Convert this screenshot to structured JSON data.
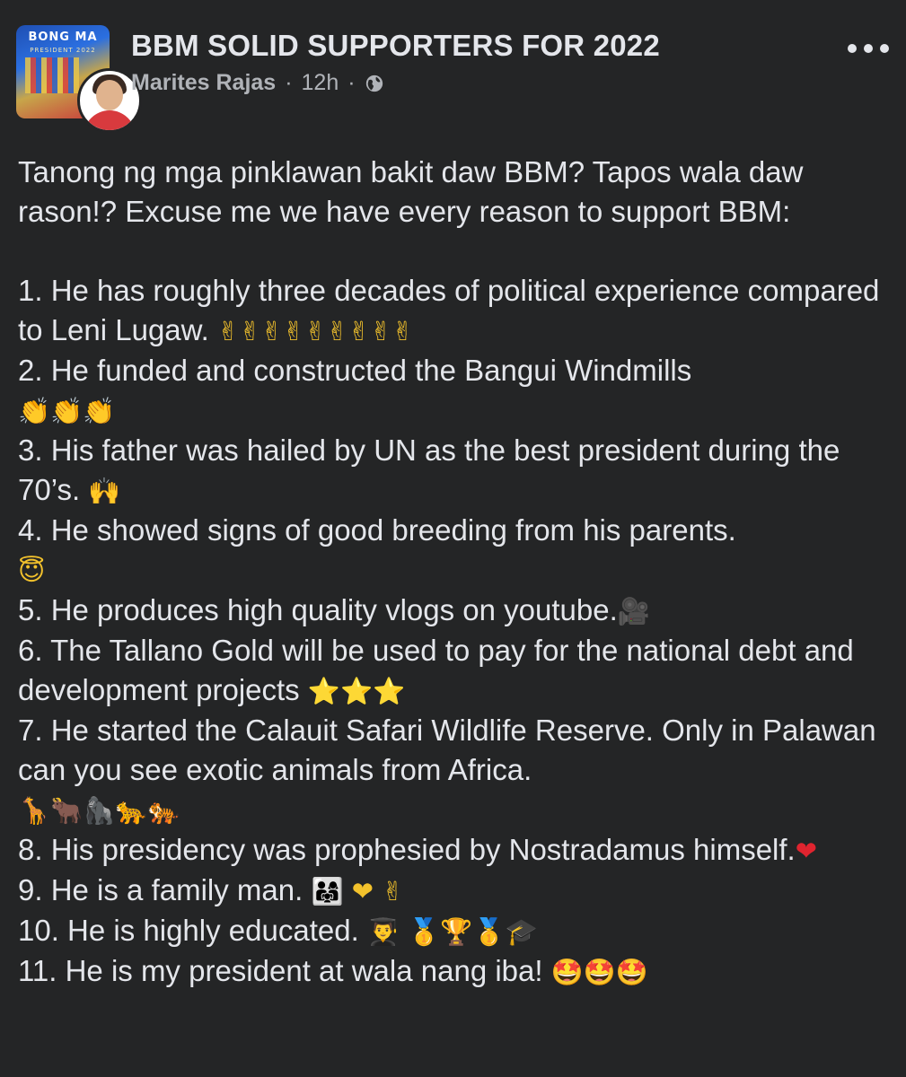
{
  "post": {
    "group_name": "BBM SOLID SUPPORTERS FOR 2022",
    "group_avatar": {
      "banner_text": "BONG MA",
      "banner_sub": "PRESIDENT 2022"
    },
    "author": "Marites Rajas",
    "separator": "·",
    "time": "12h",
    "privacy_icon": "globe-icon",
    "more_icon": "more-options-icon"
  },
  "body": {
    "intro": "Tanong ng mga pinklawan bakit daw BBM? Tapos wala daw rason!? Excuse me we have every reason to support BBM:",
    "items": [
      {
        "text": "1. He has roughly three decades of political experience compared to Leni Lugaw.",
        "emoji": "✌✌✌✌✌✌✌✌✌"
      },
      {
        "text": "2. He funded and constructed the Bangui Windmills",
        "emoji": "👏👏👏"
      },
      {
        "text": "3. His father was hailed by UN as the best president during the 70’s.",
        "emoji": "🙌"
      },
      {
        "text": "4. He showed signs of good breeding from his parents.",
        "emoji": "😇"
      },
      {
        "text": "5. He produces high quality vlogs on youtube.",
        "emoji": "🎥"
      },
      {
        "text": "6. The Tallano Gold will be used to pay for the national debt and development projects",
        "emoji": "⭐⭐⭐"
      },
      {
        "text": "7. He started the Calauit Safari Wildlife Reserve. Only in Palawan can you see exotic animals from Africa.",
        "emoji": "🦒🐂🦍🐆🐅"
      },
      {
        "text": "8. His presidency was prophesied by Nostradamus himself.",
        "emoji": "❤"
      },
      {
        "text": "9. He is a family man.",
        "emoji": "👨‍👩‍👧 ❤ ✌"
      },
      {
        "text": "10. He is highly educated.",
        "emoji": "👨‍🎓 🥇🏆🥇🎓"
      },
      {
        "text": "11. He is my president at wala nang iba!",
        "emoji": "🤩🤩🤩"
      }
    ]
  },
  "colors": {
    "background": "#242526",
    "primary_text": "#e4e6eb",
    "secondary_text": "#b0b3b8"
  }
}
